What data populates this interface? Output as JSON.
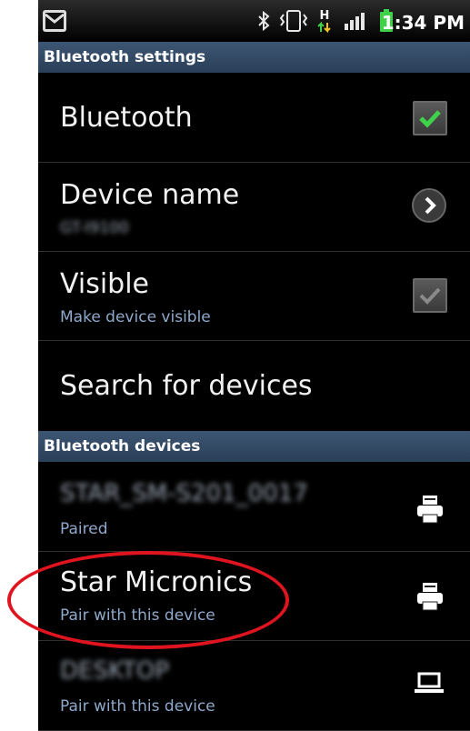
{
  "status_bar": {
    "time": "1:34 PM",
    "network_letter": "H",
    "icons": [
      "notification-icon",
      "bluetooth-icon",
      "vibrate-icon",
      "data-activity-icon",
      "signal-icon",
      "battery-icon"
    ],
    "battery_color": "#3fd14a"
  },
  "header": {
    "title": "Bluetooth settings"
  },
  "settings": {
    "bluetooth": {
      "label": "Bluetooth",
      "checked": true
    },
    "device_name": {
      "label": "Device name",
      "value": "GT-I9100"
    },
    "visible": {
      "label": "Visible",
      "summary": "Make device visible",
      "checked": false
    },
    "search": {
      "label": "Search for devices"
    }
  },
  "devices_header": "Bluetooth devices",
  "devices": [
    {
      "name": "STAR_SM-S201_0017",
      "status": "Paired",
      "icon": "printer-icon"
    },
    {
      "name": "Star Micronics",
      "status": "Pair with this device",
      "icon": "printer-icon"
    },
    {
      "name": "DESKTOP",
      "status": "Pair with this device",
      "icon": "laptop-icon"
    }
  ],
  "colors": {
    "section_header": "#34506f",
    "subtitle": "#8ea9cc",
    "check_green": "#3fd14a",
    "annotation": "#e0141e"
  }
}
